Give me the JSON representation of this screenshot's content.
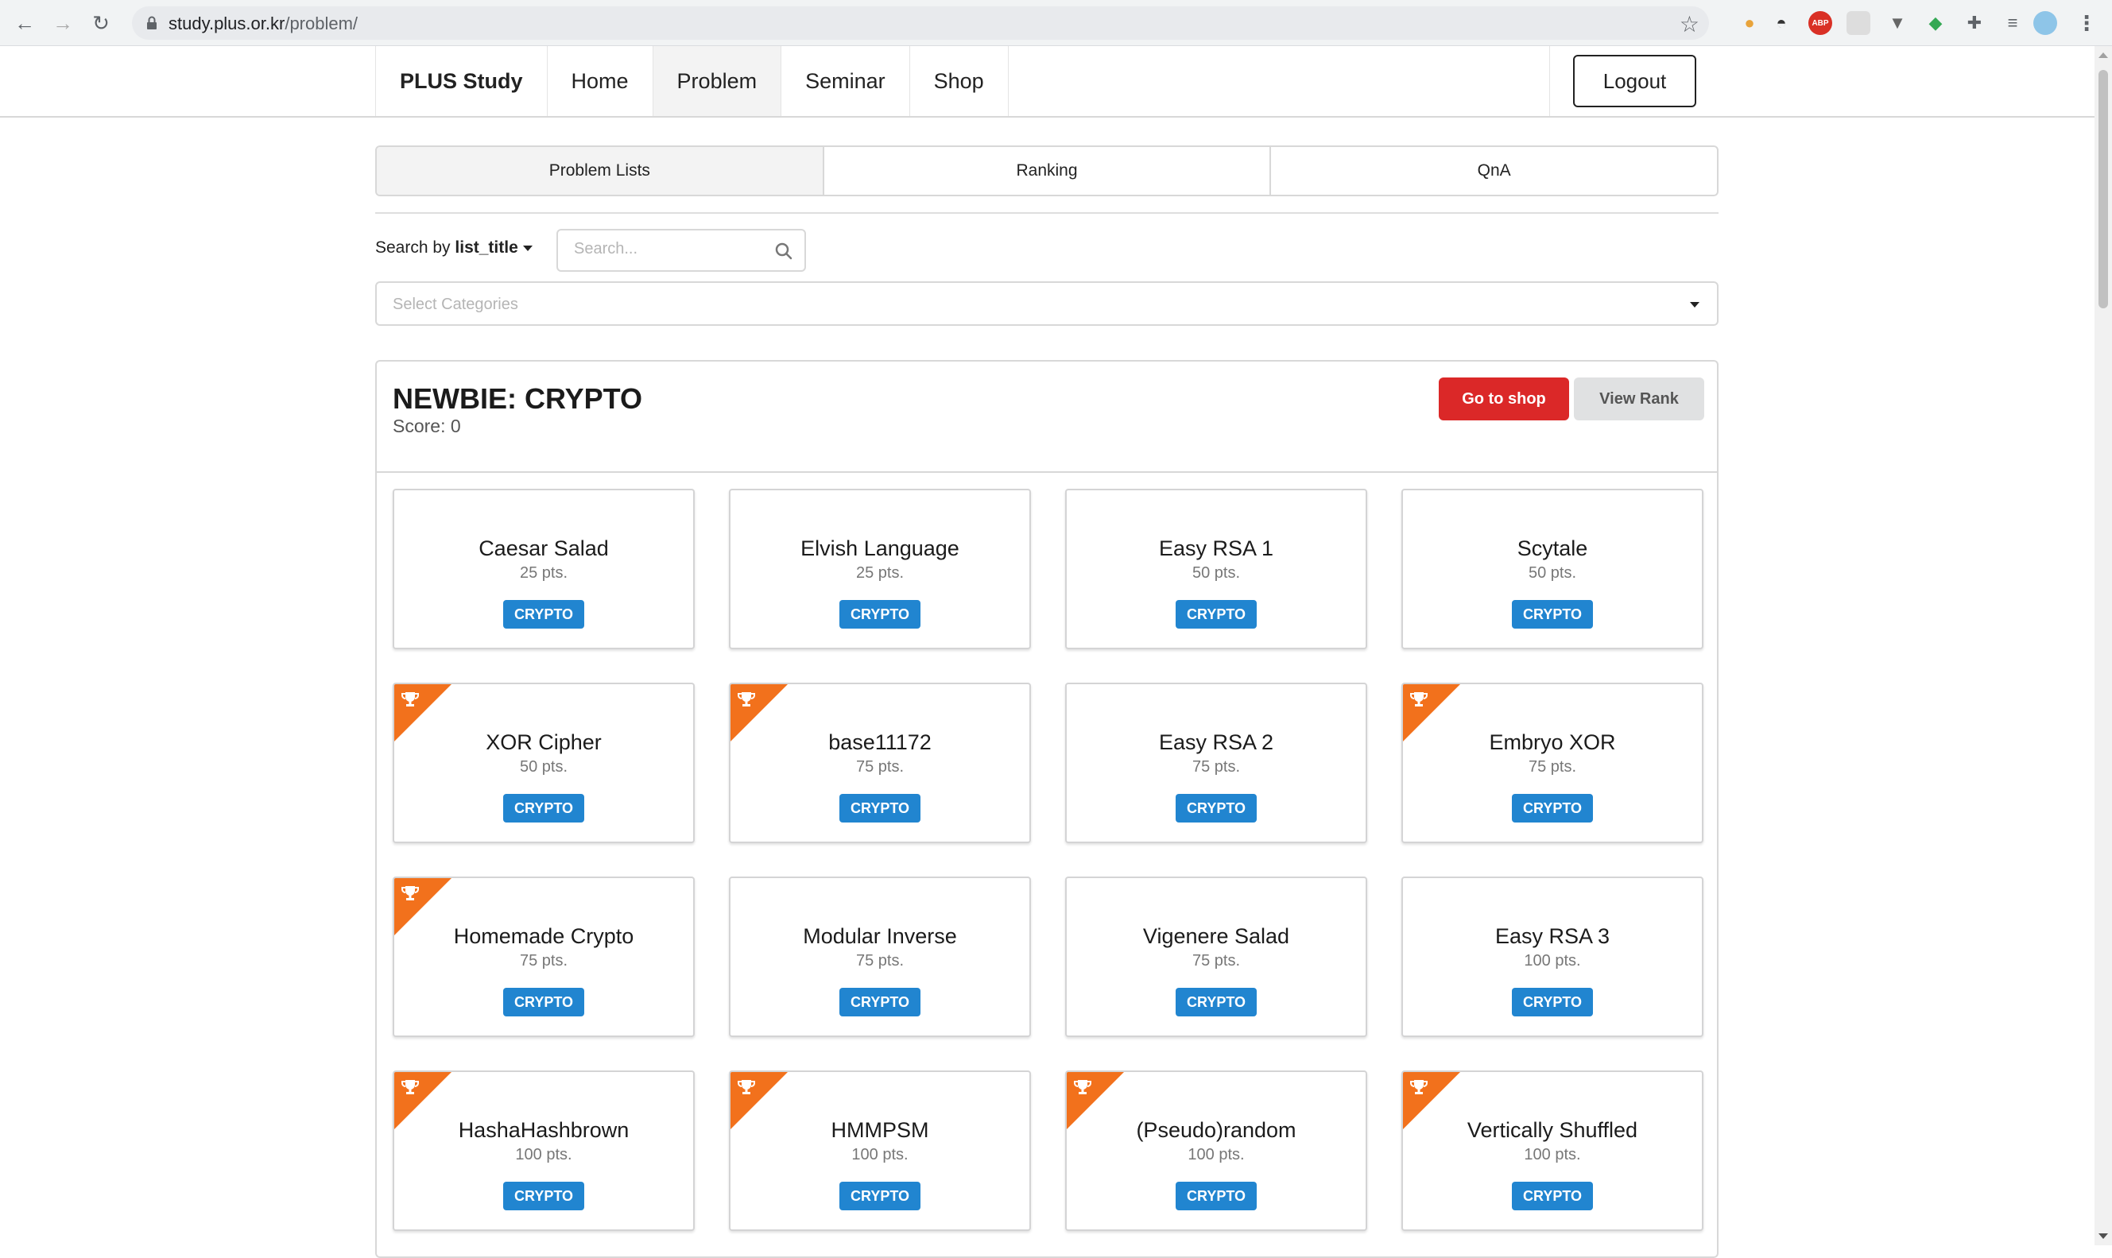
{
  "browser": {
    "url_host": "study.plus.or.kr",
    "url_path": "/problem/",
    "extensions": [
      {
        "name": "cookie-extension-icon",
        "color": "#e8a33a",
        "glyph": "●"
      },
      {
        "name": "incognito-extension-icon",
        "color": "#333333",
        "glyph": "◓"
      },
      {
        "name": "adblock-extension-icon",
        "color": "#d93025",
        "glyph": "ABP"
      },
      {
        "name": "blank-extension-icon",
        "color": "#dddddd",
        "glyph": ""
      },
      {
        "name": "vpn-extension-icon",
        "color": "#666666",
        "glyph": "▼"
      },
      {
        "name": "shield-extension-icon",
        "color": "#34a853",
        "glyph": "◆"
      },
      {
        "name": "puzzle-extension-icon",
        "color": "#5f6368",
        "glyph": "✚"
      },
      {
        "name": "playlist-icon",
        "color": "#5f6368",
        "glyph": "≡"
      }
    ]
  },
  "nav": {
    "brand": "PLUS Study",
    "items": [
      "Home",
      "Problem",
      "Seminar",
      "Shop"
    ],
    "active": "Problem",
    "logout": "Logout"
  },
  "tabs": [
    "Problem Lists",
    "Ranking",
    "QnA"
  ],
  "search": {
    "prefix": "Search by",
    "field": "list_title",
    "placeholder": "Search...",
    "categories_placeholder": "Select Categories"
  },
  "panel": {
    "title": "NEWBIE: CRYPTO",
    "score": "Score: 0",
    "shop_button": "Go to shop",
    "rank_button": "View Rank"
  },
  "colors": {
    "ribbon": "#f2711c",
    "tag": "#2185d0",
    "shop": "#db2828"
  },
  "problems": [
    {
      "title": "Caesar Salad",
      "pts": "25 pts.",
      "tag": "CRYPTO",
      "solved": false
    },
    {
      "title": "Elvish Language",
      "pts": "25 pts.",
      "tag": "CRYPTO",
      "solved": false
    },
    {
      "title": "Easy RSA 1",
      "pts": "50 pts.",
      "tag": "CRYPTO",
      "solved": false
    },
    {
      "title": "Scytale",
      "pts": "50 pts.",
      "tag": "CRYPTO",
      "solved": false
    },
    {
      "title": "XOR Cipher",
      "pts": "50 pts.",
      "tag": "CRYPTO",
      "solved": true
    },
    {
      "title": "base11172",
      "pts": "75 pts.",
      "tag": "CRYPTO",
      "solved": true
    },
    {
      "title": "Easy RSA 2",
      "pts": "75 pts.",
      "tag": "CRYPTO",
      "solved": false
    },
    {
      "title": "Embryo XOR",
      "pts": "75 pts.",
      "tag": "CRYPTO",
      "solved": true
    },
    {
      "title": "Homemade Crypto",
      "pts": "75 pts.",
      "tag": "CRYPTO",
      "solved": true
    },
    {
      "title": "Modular Inverse",
      "pts": "75 pts.",
      "tag": "CRYPTO",
      "solved": false
    },
    {
      "title": "Vigenere Salad",
      "pts": "75 pts.",
      "tag": "CRYPTO",
      "solved": false
    },
    {
      "title": "Easy RSA 3",
      "pts": "100 pts.",
      "tag": "CRYPTO",
      "solved": false
    },
    {
      "title": "HashaHashbrown",
      "pts": "100 pts.",
      "tag": "CRYPTO",
      "solved": true
    },
    {
      "title": "HMMPSM",
      "pts": "100 pts.",
      "tag": "CRYPTO",
      "solved": true
    },
    {
      "title": "(Pseudo)random",
      "pts": "100 pts.",
      "tag": "CRYPTO",
      "solved": true
    },
    {
      "title": "Vertically Shuffled",
      "pts": "100 pts.",
      "tag": "CRYPTO",
      "solved": true
    }
  ]
}
